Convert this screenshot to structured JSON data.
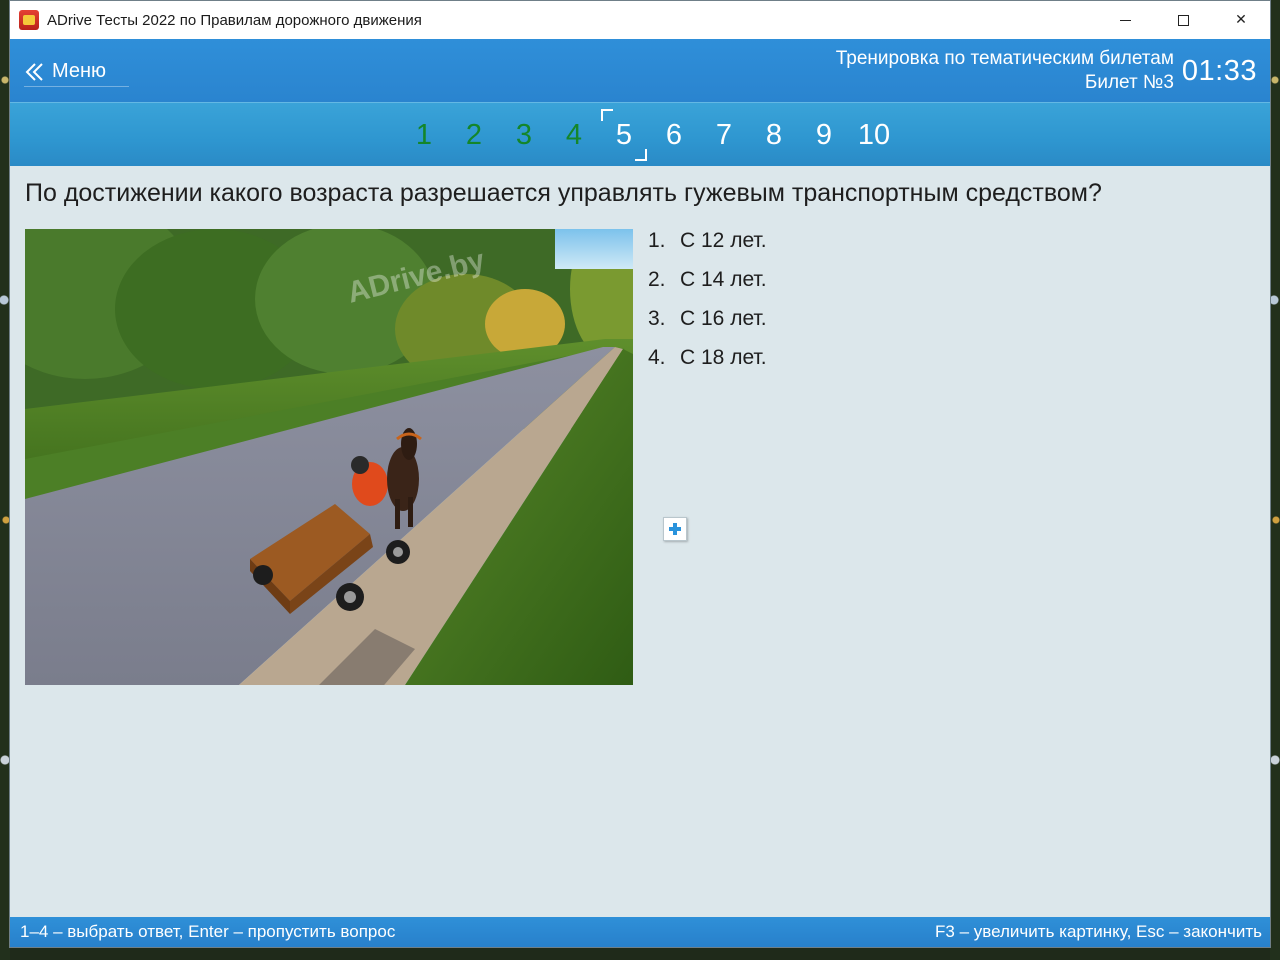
{
  "window": {
    "title": "ADrive Тесты 2022 по Правилам дорожного движения",
    "controls": {
      "minimize": "minimize",
      "maximize": "maximize",
      "close": "✕"
    }
  },
  "header": {
    "menu_label": "Меню",
    "mode": "Тренировка по тематическим билетам",
    "ticket": "Билет №3",
    "timer": "01:33"
  },
  "question_nav": {
    "items": [
      {
        "label": "1",
        "state": "answered"
      },
      {
        "label": "2",
        "state": "answered"
      },
      {
        "label": "3",
        "state": "answered"
      },
      {
        "label": "4",
        "state": "answered"
      },
      {
        "label": "5",
        "state": "current"
      },
      {
        "label": "6",
        "state": "pending"
      },
      {
        "label": "7",
        "state": "pending"
      },
      {
        "label": "8",
        "state": "pending"
      },
      {
        "label": "9",
        "state": "pending"
      },
      {
        "label": "10",
        "state": "pending"
      }
    ]
  },
  "question": {
    "text": "По достижении какого возраста разрешается управлять гужевым транспортным средством?",
    "watermark": "ADrive.by"
  },
  "answers": [
    {
      "num": "1.",
      "text": "С 12 лет."
    },
    {
      "num": "2.",
      "text": "С 14 лет."
    },
    {
      "num": "3.",
      "text": "С 16 лет."
    },
    {
      "num": "4.",
      "text": "С 18 лет."
    }
  ],
  "footer": {
    "left": "1–4 – выбрать ответ, Enter – пропустить вопрос",
    "right": "F3 – увеличить картинку, Esc – закончить"
  },
  "colors": {
    "header_blue": "#2a84cf",
    "answered_green": "#14862a",
    "content_bg": "#dce7eb"
  }
}
